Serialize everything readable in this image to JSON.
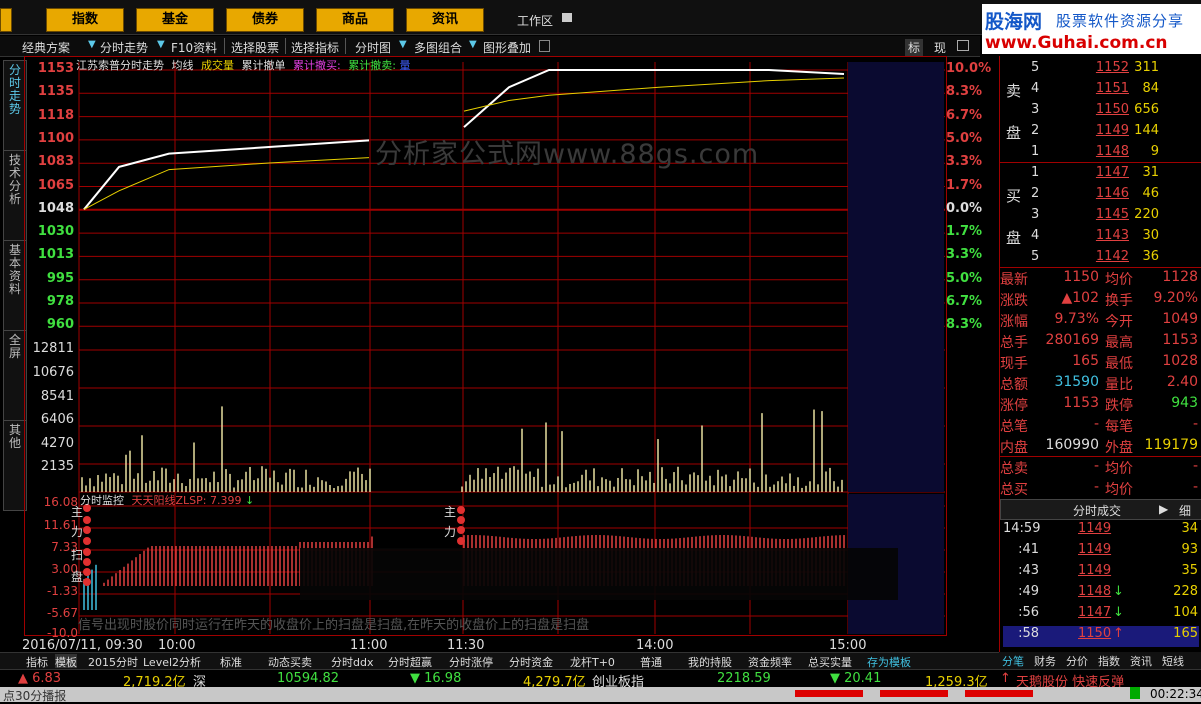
{
  "menu": {
    "items": [
      "指数",
      "基金",
      "债券",
      "商品",
      "资讯"
    ],
    "workarea": "工作区"
  },
  "logo": {
    "line1a": "股海网",
    "line1b": "股票软件资源分享",
    "line2": "www.Guhai.com.cn"
  },
  "toolbar": {
    "items": [
      "经典方案",
      "分时走势",
      "F10资料",
      "选择股票",
      "选择指标",
      "分时图",
      "多图组合",
      "图形叠加"
    ],
    "mode_a": "标",
    "mode_b": "现"
  },
  "left_tabs": [
    "分时走势",
    "技术分析",
    "基本资料",
    "全屏",
    "其他"
  ],
  "chart": {
    "title_stock": "江苏索普分时走势",
    "legend_avg": "均线",
    "legend_vol": "成交量",
    "legend_order": "累计撤单",
    "legend_buy": "累计撤买:",
    "legend_sell": "累计撤卖:",
    "legend_blue": "量",
    "watermark": "分析家公式网www.88gs.com",
    "note": "信号出现时股价同时运行在昨天的收盘价上的扫盘是扫盘,在昨天的收盘价上的扫盘是扫盘",
    "indicator_title": "分时监控",
    "indicator_name": "天天阳线ZLSP:",
    "indicator_value": "7.399",
    "price_labels": [
      "1153",
      "1135",
      "1118",
      "1100",
      "1083",
      "1065",
      "1048",
      "1030",
      "1013",
      "995",
      "978",
      "960"
    ],
    "pct_labels": [
      "10.0%",
      "8.3%",
      "6.7%",
      "5.0%",
      "3.3%",
      "1.7%",
      "0.0%",
      "1.7%",
      "3.3%",
      "5.0%",
      "6.7%",
      "8.3%"
    ],
    "vol_labels": [
      "12811",
      "10676",
      "8541",
      "6406",
      "4270",
      "2135"
    ],
    "ind_labels": [
      "16.08",
      "11.61",
      "7.33",
      "3.00",
      "-1.33",
      "-5.67",
      "-10.0"
    ],
    "time_labels": [
      "2016/07/11, 09:30",
      "10:00",
      "11:00",
      "11:30",
      "14:00",
      "15:00"
    ],
    "marker_labels_a": [
      "主",
      "力",
      "扫",
      "盘"
    ],
    "marker_labels_b": [
      "主",
      "力"
    ]
  },
  "chart_data": {
    "type": "line",
    "title": "江苏索普分时走势",
    "prev_close": 1048,
    "ylim": [
      960,
      1153
    ],
    "x": [
      "09:30",
      "09:45",
      "10:00",
      "10:30",
      "11:00",
      "11:30",
      "13:15",
      "13:30",
      "14:00",
      "14:30",
      "15:00"
    ],
    "series": [
      {
        "name": "price",
        "values": [
          1048,
          1080,
          1090,
          1095,
          1100,
          1110,
          1140,
          1153,
          1153,
          1153,
          1150
        ]
      },
      {
        "name": "均线",
        "values": [
          1048,
          1062,
          1078,
          1083,
          1087,
          1122,
          1130,
          1134,
          1140,
          1145,
          1147
        ]
      }
    ],
    "volume_ylim": [
      0,
      12811
    ]
  },
  "orderbook": {
    "sell_label": "卖盘",
    "buy_label": "买盘",
    "sell": [
      {
        "lv": "5",
        "price": "1152",
        "vol": "311"
      },
      {
        "lv": "4",
        "price": "1151",
        "vol": "84"
      },
      {
        "lv": "3",
        "price": "1150",
        "vol": "656"
      },
      {
        "lv": "2",
        "price": "1149",
        "vol": "144"
      },
      {
        "lv": "1",
        "price": "1148",
        "vol": "9"
      }
    ],
    "buy": [
      {
        "lv": "1",
        "price": "1147",
        "vol": "31"
      },
      {
        "lv": "2",
        "price": "1146",
        "vol": "46"
      },
      {
        "lv": "3",
        "price": "1145",
        "vol": "220"
      },
      {
        "lv": "4",
        "price": "1143",
        "vol": "30"
      },
      {
        "lv": "5",
        "price": "1142",
        "vol": "36"
      }
    ]
  },
  "quote": [
    {
      "l1": "最新",
      "v1": "1150",
      "l2": "均价",
      "v2": "1128"
    },
    {
      "l1": "涨跌",
      "v1": "▲102",
      "l2": "换手",
      "v2": "9.20%"
    },
    {
      "l1": "涨幅",
      "v1": "9.73%",
      "l2": "今开",
      "v2": "1049"
    },
    {
      "l1": "总手",
      "v1": "280169",
      "l2": "最高",
      "v2": "1153"
    },
    {
      "l1": "现手",
      "v1": "165",
      "l2": "最低",
      "v2": "1028"
    },
    {
      "l1": "总额",
      "v1": "31590",
      "l2": "量比",
      "v2": "2.40"
    },
    {
      "l1": "涨停",
      "v1": "1153",
      "l2": "跌停",
      "v2": "943"
    },
    {
      "l1": "总笔",
      "v1": "-",
      "l2": "每笔",
      "v2": "-"
    },
    {
      "l1": "内盘",
      "v1": "160990",
      "l2": "外盘",
      "v2": "119179"
    },
    {
      "l1": "总卖",
      "v1": "-",
      "l2": "均价",
      "v2": "-"
    },
    {
      "l1": "总买",
      "v1": "-",
      "l2": "均价",
      "v2": "-"
    }
  ],
  "ticks_header": "分时成交",
  "ticks_detail": "细",
  "ticks": [
    {
      "t": "14:59",
      "p": "1149",
      "v": "34",
      "arrow": ""
    },
    {
      "t": ":41",
      "p": "1149",
      "v": "93",
      "arrow": ""
    },
    {
      "t": ":43",
      "p": "1149",
      "v": "35",
      "arrow": ""
    },
    {
      "t": ":49",
      "p": "1148",
      "v": "228",
      "arrow": "down"
    },
    {
      "t": ":56",
      "p": "1147",
      "v": "104",
      "arrow": "down"
    },
    {
      "t": ":58",
      "p": "1150",
      "v": "165",
      "arrow": "up"
    }
  ],
  "right_tabs": [
    "分笔",
    "财务",
    "分价",
    "指数",
    "资讯",
    "短线"
  ],
  "bottom_tabs": [
    "指标",
    "模板",
    "2015分时",
    "Level2分析",
    "标准",
    "动态买卖",
    "分时ddx",
    "分时超赢",
    "分时涨停",
    "分时资金",
    "龙杆T+0",
    "普通",
    "我的持股",
    "资金频率",
    "总买实量",
    "存为模板"
  ],
  "ticker": {
    "a": "▲ 6.83",
    "b": "2,719.2亿",
    "c": "深",
    "d": "10594.82",
    "e": "▼ 16.98",
    "f": "4,279.7亿",
    "g": "创业板指",
    "h": "2218.59",
    "i": "▼ 20.41",
    "j": "1,259.3亿",
    "k": "天鹅股份 快速反弹"
  },
  "status": {
    "left": "点30分播报",
    "time": "00:22:34"
  }
}
